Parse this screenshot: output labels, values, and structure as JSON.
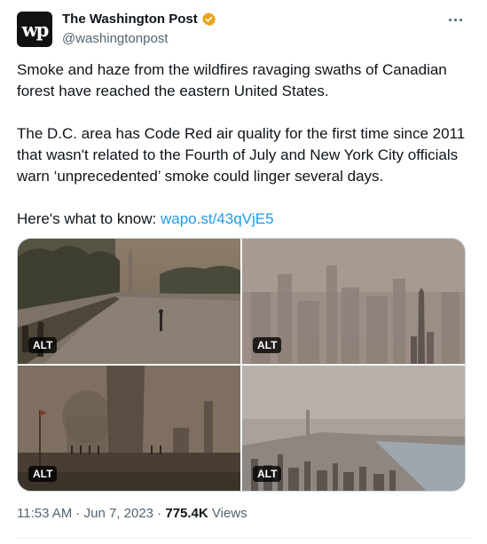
{
  "author": {
    "avatar_text": "wp",
    "display_name": "The Washington Post",
    "handle": "@washingtonpost",
    "verified_badge": "verified-badge-icon",
    "badge_color": "#e8a317"
  },
  "tweet": {
    "paragraph1": "Smoke and haze from the wildfires ravaging swaths of Canadian forest have reached the eastern United States.",
    "paragraph2": "The D.C. area has Code Red air quality for the first time since 2011 that wasn't related to the Fourth of July and New York City officials warn ‘unprecedented’ smoke could linger several days.",
    "paragraph3_prefix": "Here's what to know: ",
    "link_text": "wapo.st/43qVjE5"
  },
  "media": {
    "alt_label": "ALT",
    "images": [
      {
        "name": "lincoln-memorial-reflecting-pool-image"
      },
      {
        "name": "new-york-skyline-haze-image"
      },
      {
        "name": "washington-monument-haze-image"
      },
      {
        "name": "manhattan-aerial-haze-image"
      }
    ]
  },
  "meta": {
    "time": "11:53 AM",
    "separator": " · ",
    "date": "Jun 7, 2023",
    "views_count": "775.4K",
    "views_label": " Views"
  },
  "colors": {
    "link": "#1d9bf0",
    "secondary_text": "#536471",
    "primary_text": "#0f1419"
  }
}
